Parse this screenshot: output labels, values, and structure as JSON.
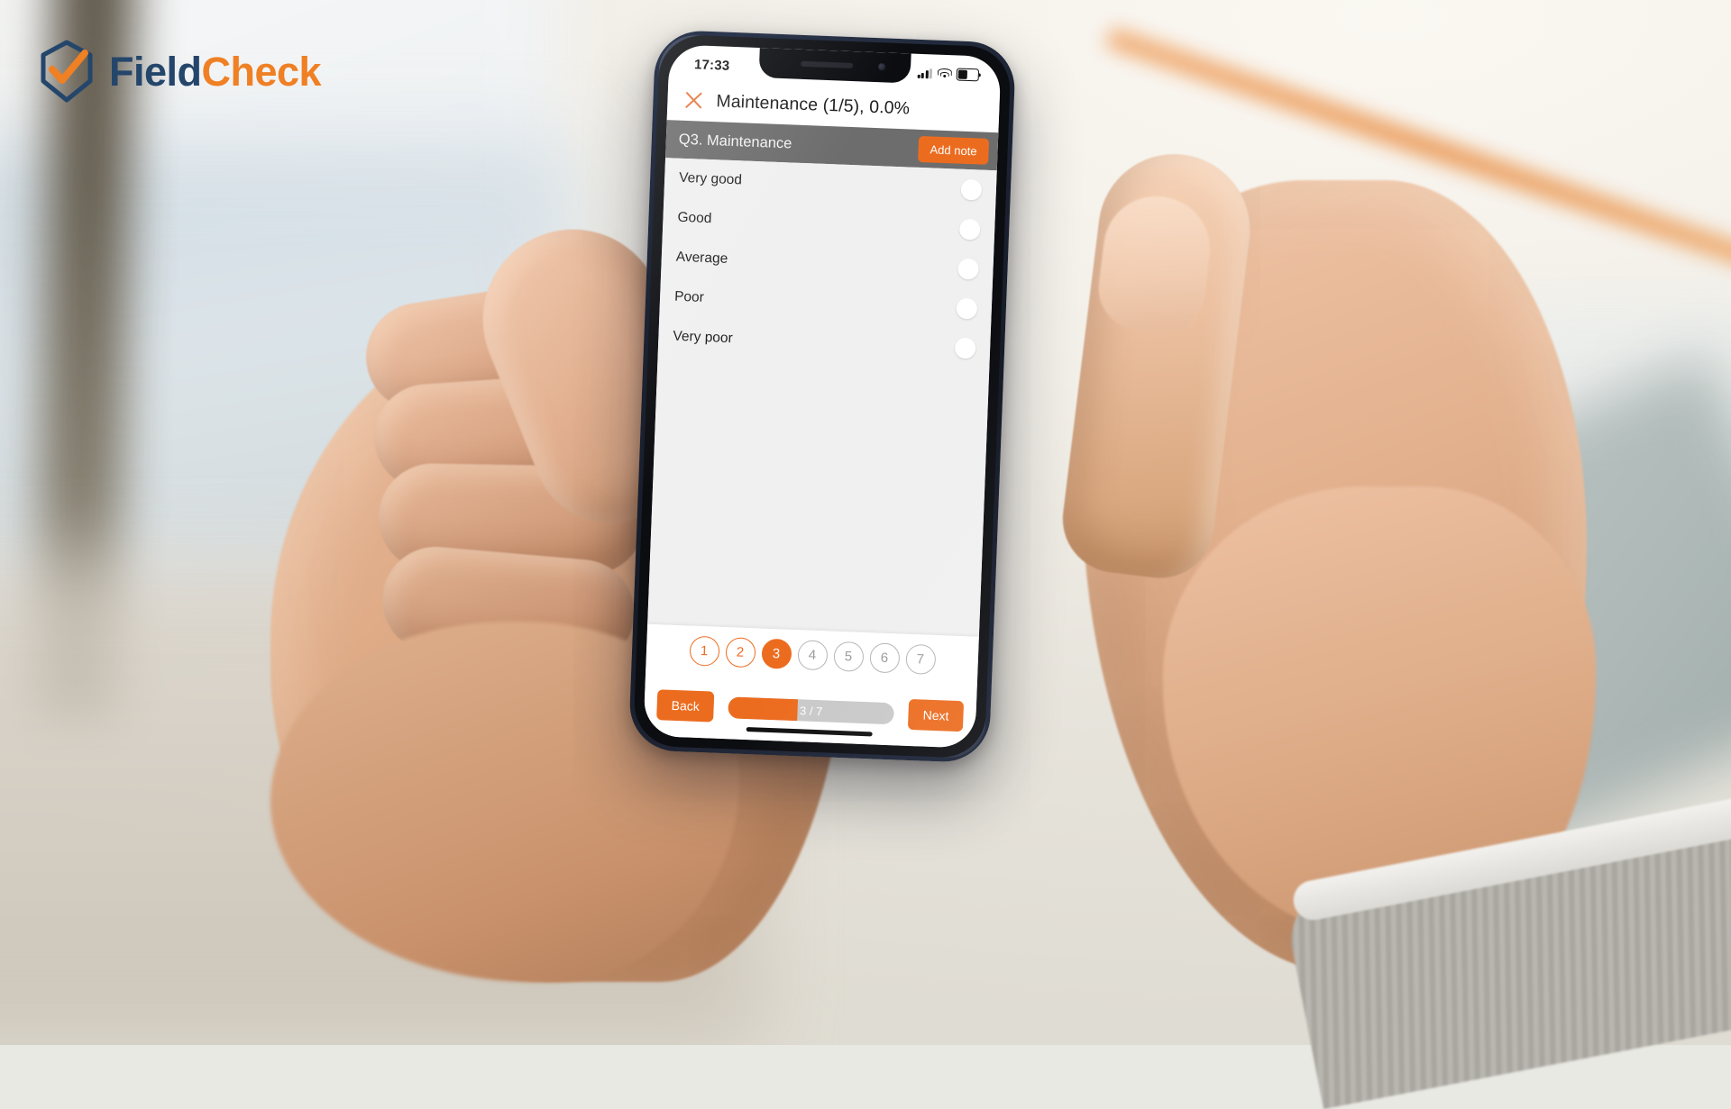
{
  "brand": {
    "name_part1": "Field",
    "name_part2": "Check",
    "logo_icon": "hexagon-shield-check-icon",
    "navy": "#24466b",
    "orange": "#ef8024"
  },
  "phone": {
    "status_bar": {
      "time": "17:33",
      "cellular_icon": "cellular-signal-icon",
      "wifi_icon": "wifi-icon",
      "battery_icon": "battery-icon",
      "battery_level_pct": 50
    },
    "app_header": {
      "close_icon": "close-x-icon",
      "title": "Maintenance (1/5), 0.0%"
    },
    "question_bar": {
      "question_label": "Q3. Maintenance",
      "add_note_label": "Add note"
    },
    "options": [
      {
        "label": "Very good",
        "selected": false
      },
      {
        "label": "Good",
        "selected": false
      },
      {
        "label": "Average",
        "selected": false
      },
      {
        "label": "Poor",
        "selected": false
      },
      {
        "label": "Very poor",
        "selected": false
      }
    ],
    "pagination": [
      {
        "number": "1",
        "state": "done"
      },
      {
        "number": "2",
        "state": "done"
      },
      {
        "number": "3",
        "state": "active"
      },
      {
        "number": "4",
        "state": "upcoming"
      },
      {
        "number": "5",
        "state": "upcoming"
      },
      {
        "number": "6",
        "state": "upcoming"
      },
      {
        "number": "7",
        "state": "upcoming"
      }
    ],
    "footer": {
      "back_label": "Back",
      "next_label": "Next",
      "progress_text": "3 / 7",
      "progress_pct": 42
    },
    "accent_color": "#ec6c1f",
    "question_bar_color": "#6d6d6d"
  }
}
